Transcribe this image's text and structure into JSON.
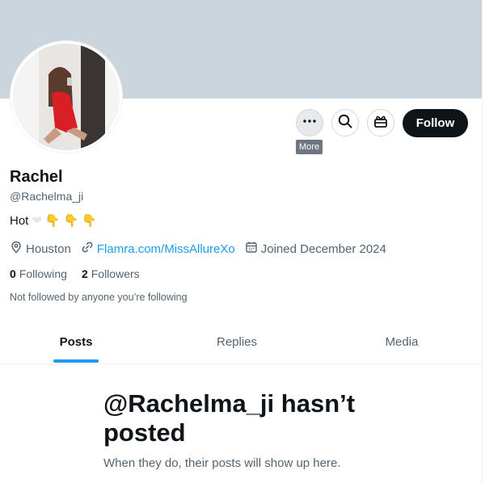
{
  "profile": {
    "name": "Rachel",
    "handle": "@Rachelma_ji",
    "bio_text": "Hot",
    "location": "Houston",
    "website": "Flamra.com/MissAllureXo",
    "joined": "Joined December 2024",
    "following_count": "0",
    "following_label": "Following",
    "followers_count": "2",
    "followers_label": "Followers",
    "not_followed_text": "Not followed by anyone you’re following"
  },
  "actions": {
    "more_tooltip": "More",
    "follow_label": "Follow"
  },
  "tabs": [
    {
      "label": "Posts",
      "active": true
    },
    {
      "label": "Replies",
      "active": false
    },
    {
      "label": "Media",
      "active": false
    }
  ],
  "empty_state": {
    "title": "@Rachelma_ji hasn’t posted",
    "subtitle": "When they do, their posts will show up here."
  },
  "colors": {
    "banner": "#cbd5dd",
    "accent": "#1d9bf0",
    "follow_button": "#0f1419",
    "muted_text": "#536471"
  },
  "icons": [
    "more-icon",
    "search-icon",
    "gift-icon",
    "location-icon",
    "link-icon",
    "calendar-icon",
    "white-heart-emoji",
    "pointing-down-emoji"
  ]
}
